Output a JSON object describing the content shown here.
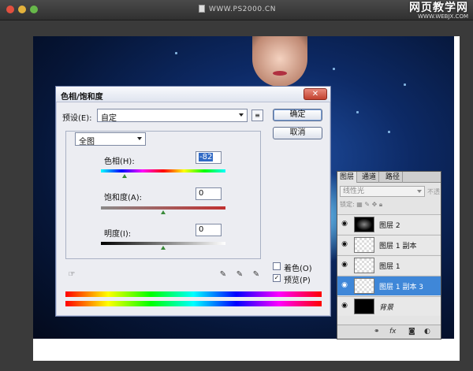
{
  "window": {
    "doc_title": "WWW.PS2000.CN",
    "watermark_title": "网页教学网",
    "watermark_url": "WWW.WEBJX.COM"
  },
  "dialog": {
    "title": "色相/饱和度",
    "preset_label": "预设(E):",
    "preset_value": "自定",
    "ok_label": "确定",
    "cancel_label": "取消",
    "channel_value": "全图",
    "hue_label": "色相(H):",
    "hue_value": "-82",
    "saturation_label": "饱和度(A):",
    "saturation_value": "0",
    "lightness_label": "明度(I):",
    "lightness_value": "0",
    "colorize_label": "着色(O)",
    "colorize_checked": false,
    "preview_label": "预览(P)",
    "preview_checked": true,
    "hue_level": -82,
    "saturation_level": 0,
    "lightness_level": 0
  },
  "layers_panel": {
    "tabs": [
      "图层",
      "通道",
      "路径"
    ],
    "blend_mode": "线性光",
    "opacity_hint": "不透",
    "lock_label": "锁定:",
    "layers": [
      {
        "name": "图层 2",
        "thumb": "dark-texture",
        "selected": false
      },
      {
        "name": "图层 1 副本",
        "thumb": "checker-figure",
        "selected": false
      },
      {
        "name": "图层 1",
        "thumb": "checker-figure",
        "selected": false
      },
      {
        "name": "图层 1 副本 3",
        "thumb": "checker-figure",
        "selected": true
      },
      {
        "name": "背景",
        "thumb": "dark-bg",
        "selected": false
      }
    ],
    "footer_icons": [
      "link-icon",
      "fx-icon",
      "mask-icon",
      "adjustment-icon"
    ]
  }
}
